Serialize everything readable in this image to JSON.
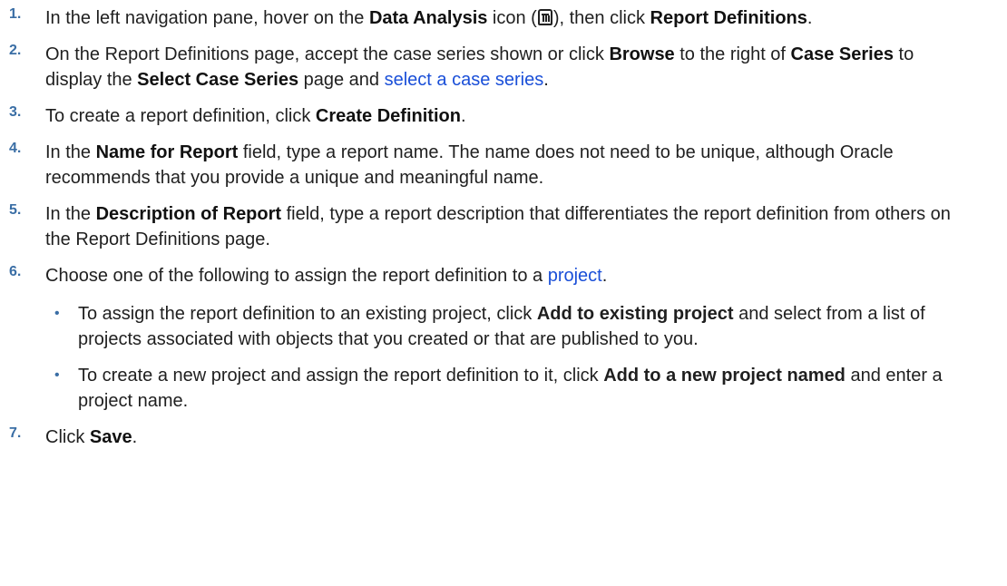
{
  "steps": [
    {
      "num": "1.",
      "parts": [
        {
          "t": "In the left navigation pane, hover on the "
        },
        {
          "b": "Data Analysis"
        },
        {
          "t": " icon ("
        },
        {
          "icon": "data-analysis-icon"
        },
        {
          "t": "), then click "
        },
        {
          "b": "Report Definitions"
        },
        {
          "t": "."
        }
      ]
    },
    {
      "num": "2.",
      "parts": [
        {
          "t": "On the Report Definitions page, accept the case series shown or click "
        },
        {
          "b": "Browse"
        },
        {
          "t": " to the right of "
        },
        {
          "b": "Case Series"
        },
        {
          "t": " to display the "
        },
        {
          "b": "Select Case Series"
        },
        {
          "t": " page and "
        },
        {
          "a": "select a case series"
        },
        {
          "t": "."
        }
      ]
    },
    {
      "num": "3.",
      "parts": [
        {
          "t": "To create a report definition, click "
        },
        {
          "b": "Create Definition"
        },
        {
          "t": "."
        }
      ]
    },
    {
      "num": "4.",
      "parts": [
        {
          "t": "In the "
        },
        {
          "b": "Name for Report"
        },
        {
          "t": " field, type a report name. The name does not need to be unique, although Oracle recommends that you provide a unique and meaningful name."
        }
      ]
    },
    {
      "num": "5.",
      "parts": [
        {
          "t": "In the "
        },
        {
          "b": "Description of Report"
        },
        {
          "t": " field, type a report description that differentiates the report definition from others on the Report Definitions page."
        }
      ]
    },
    {
      "num": "6.",
      "parts": [
        {
          "t": "Choose one of the following to assign the report definition to a "
        },
        {
          "a": "project"
        },
        {
          "t": "."
        }
      ],
      "subs": [
        {
          "bullet": "•",
          "parts": [
            {
              "t": "To assign the report definition to an existing project, click "
            },
            {
              "b": "Add to existing project"
            },
            {
              "t": " and select from a list of projects associated with objects that you created or that are published to you."
            }
          ]
        },
        {
          "bullet": "•",
          "parts": [
            {
              "t": "To create a new project and assign the report definition to it, click "
            },
            {
              "b": "Add to a new project named"
            },
            {
              "t": " and enter a project name."
            }
          ]
        }
      ]
    },
    {
      "num": "7.",
      "parts": [
        {
          "t": "Click "
        },
        {
          "b": "Save"
        },
        {
          "t": "."
        }
      ]
    }
  ]
}
